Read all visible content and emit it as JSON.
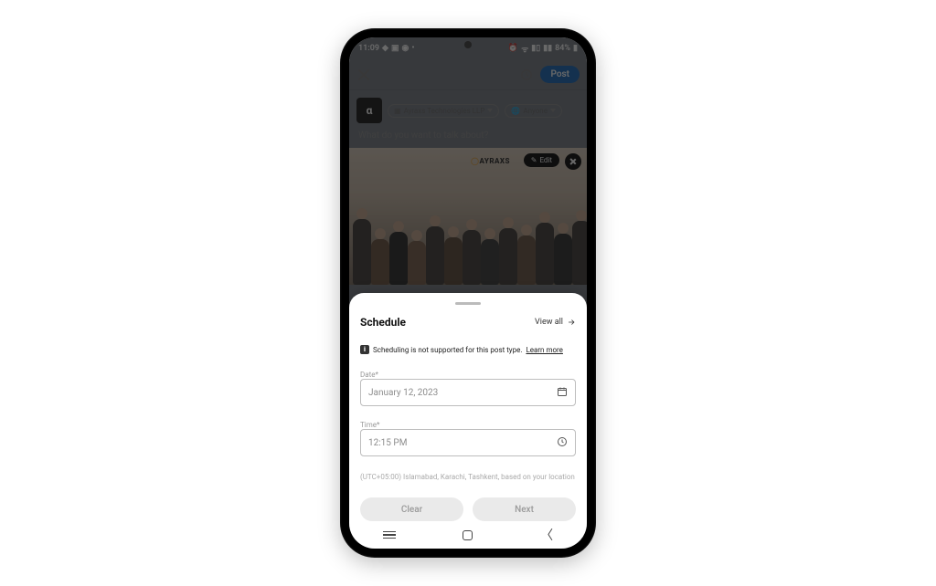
{
  "status": {
    "time": "11:09",
    "battery": "84%"
  },
  "appbar": {
    "post_label": "Post"
  },
  "author": {
    "avatar_letter": "α",
    "org_label": "Ayraxs Technologies LLP",
    "audience_label": "Anyone"
  },
  "composer": {
    "prompt": "What do you want to talk about?",
    "brand_prefix": "AYRAXS",
    "edit_label": "Edit"
  },
  "sheet": {
    "title": "Schedule",
    "view_all": "View all",
    "info_text": "Scheduling is not supported for this post type.",
    "learn_more": "Learn more",
    "date_label": "Date*",
    "date_value": "January 12, 2023",
    "time_label": "Time*",
    "time_value": "12:15 PM",
    "timezone_text": "(UTC+05:00) Islamabad, Karachi, Tashkent, based on your location",
    "clear_label": "Clear",
    "next_label": "Next"
  }
}
